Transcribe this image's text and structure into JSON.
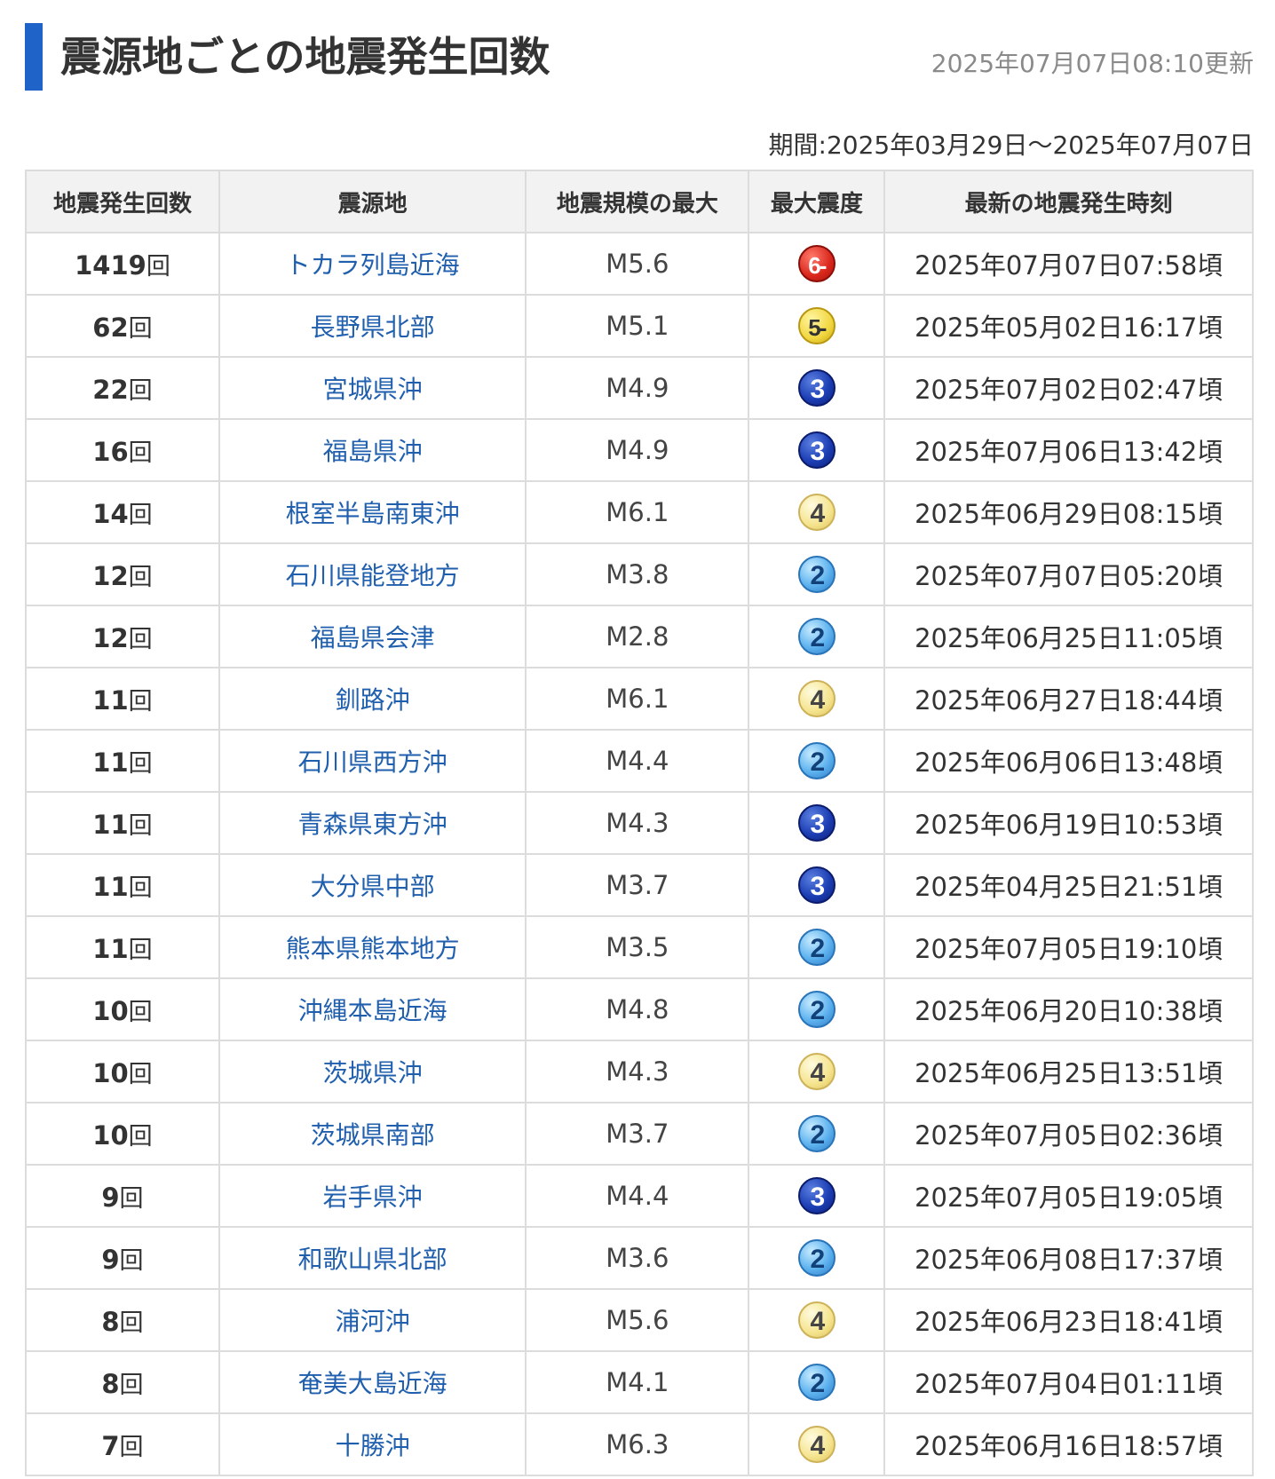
{
  "header": {
    "title": "震源地ごとの地震発生回数",
    "updated": "2025年07月07日08:10更新",
    "period": "期間:2025年03月29日〜2025年07月07日"
  },
  "table": {
    "columns": [
      "地震発生回数",
      "震源地",
      "地震規模の最大",
      "最大震度",
      "最新の地震発生時刻"
    ],
    "unit": "回",
    "rows": [
      {
        "count": "1419",
        "place": "トカラ列島近海",
        "mag": "M5.6",
        "intensity": "6-",
        "cls": "s6m",
        "time": "2025年07月07日07:58頃"
      },
      {
        "count": "62",
        "place": "長野県北部",
        "mag": "M5.1",
        "intensity": "5-",
        "cls": "s5m",
        "time": "2025年05月02日16:17頃"
      },
      {
        "count": "22",
        "place": "宮城県沖",
        "mag": "M4.9",
        "intensity": "3",
        "cls": "s3",
        "time": "2025年07月02日02:47頃"
      },
      {
        "count": "16",
        "place": "福島県沖",
        "mag": "M4.9",
        "intensity": "3",
        "cls": "s3",
        "time": "2025年07月06日13:42頃"
      },
      {
        "count": "14",
        "place": "根室半島南東沖",
        "mag": "M6.1",
        "intensity": "4",
        "cls": "s4",
        "time": "2025年06月29日08:15頃"
      },
      {
        "count": "12",
        "place": "石川県能登地方",
        "mag": "M3.8",
        "intensity": "2",
        "cls": "s2",
        "time": "2025年07月07日05:20頃"
      },
      {
        "count": "12",
        "place": "福島県会津",
        "mag": "M2.8",
        "intensity": "2",
        "cls": "s2",
        "time": "2025年06月25日11:05頃"
      },
      {
        "count": "11",
        "place": "釧路沖",
        "mag": "M6.1",
        "intensity": "4",
        "cls": "s4",
        "time": "2025年06月27日18:44頃"
      },
      {
        "count": "11",
        "place": "石川県西方沖",
        "mag": "M4.4",
        "intensity": "2",
        "cls": "s2",
        "time": "2025年06月06日13:48頃"
      },
      {
        "count": "11",
        "place": "青森県東方沖",
        "mag": "M4.3",
        "intensity": "3",
        "cls": "s3",
        "time": "2025年06月19日10:53頃"
      },
      {
        "count": "11",
        "place": "大分県中部",
        "mag": "M3.7",
        "intensity": "3",
        "cls": "s3",
        "time": "2025年04月25日21:51頃"
      },
      {
        "count": "11",
        "place": "熊本県熊本地方",
        "mag": "M3.5",
        "intensity": "2",
        "cls": "s2",
        "time": "2025年07月05日19:10頃"
      },
      {
        "count": "10",
        "place": "沖縄本島近海",
        "mag": "M4.8",
        "intensity": "2",
        "cls": "s2",
        "time": "2025年06月20日10:38頃"
      },
      {
        "count": "10",
        "place": "茨城県沖",
        "mag": "M4.3",
        "intensity": "4",
        "cls": "s4",
        "time": "2025年06月25日13:51頃"
      },
      {
        "count": "10",
        "place": "茨城県南部",
        "mag": "M3.7",
        "intensity": "2",
        "cls": "s2",
        "time": "2025年07月05日02:36頃"
      },
      {
        "count": "9",
        "place": "岩手県沖",
        "mag": "M4.4",
        "intensity": "3",
        "cls": "s3",
        "time": "2025年07月05日19:05頃"
      },
      {
        "count": "9",
        "place": "和歌山県北部",
        "mag": "M3.6",
        "intensity": "2",
        "cls": "s2",
        "time": "2025年06月08日17:37頃"
      },
      {
        "count": "8",
        "place": "浦河沖",
        "mag": "M5.6",
        "intensity": "4",
        "cls": "s4",
        "time": "2025年06月23日18:41頃"
      },
      {
        "count": "8",
        "place": "奄美大島近海",
        "mag": "M4.1",
        "intensity": "2",
        "cls": "s2",
        "time": "2025年07月04日01:11頃"
      },
      {
        "count": "7",
        "place": "十勝沖",
        "mag": "M6.3",
        "intensity": "4",
        "cls": "s4",
        "time": "2025年06月16日18:57頃"
      }
    ]
  },
  "colors": {
    "accent": "#1f63c9",
    "link": "#1f5fae",
    "header_bg": "#f2f2f2",
    "border": "#dcdcdc",
    "muted": "#8a8a8a"
  }
}
